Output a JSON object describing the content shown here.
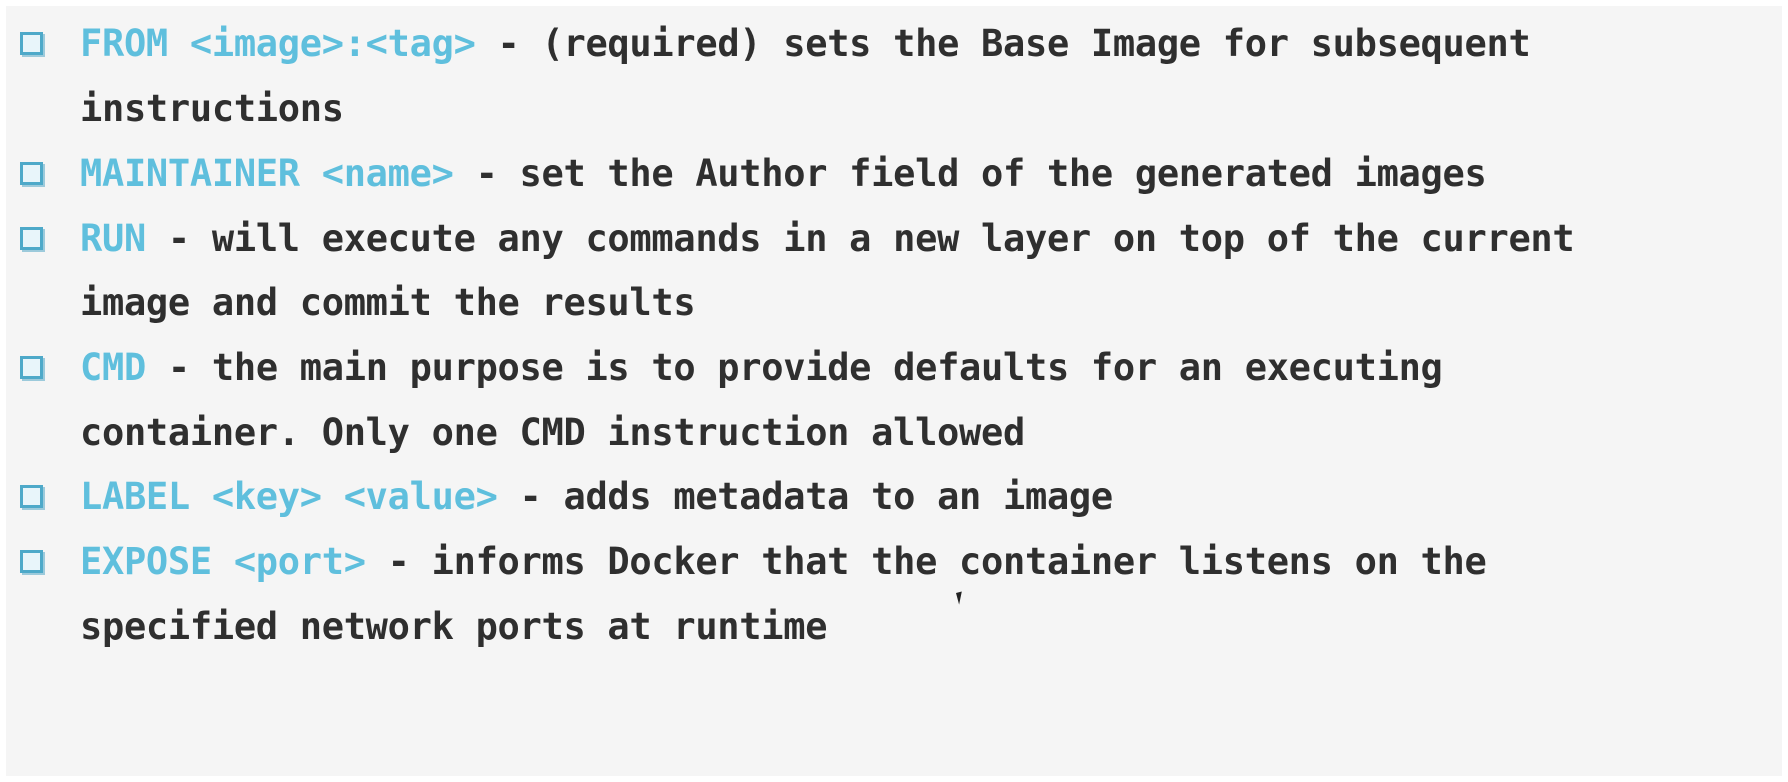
{
  "items": [
    {
      "keyword": "FROM <image>:<tag>",
      "description": " - (required) sets the Base Image for subsequent",
      "continuation": "instructions"
    },
    {
      "keyword": "MAINTAINER <name>",
      "description": " - set the Author field of the generated images"
    },
    {
      "keyword": "RUN",
      "description": " - will execute any commands in a new layer on top of the current",
      "continuation": "image and commit the results"
    },
    {
      "keyword": "CMD",
      "description": " - the main purpose is to provide defaults for an executing",
      "continuation": "container. Only one CMD instruction allowed"
    },
    {
      "keyword": "LABEL <key> <value>",
      "description": " - adds metadata to an image"
    },
    {
      "keyword": "EXPOSE <port>",
      "description": " - informs Docker that the container listens on the",
      "continuation": "specified network ports at runtime"
    }
  ],
  "colors": {
    "keyword": "#5fbfdd",
    "text": "#2f2f2f",
    "background": "#f5f5f5",
    "checkbox_border": "#4ea9c9"
  },
  "icons": {
    "bullet": "checkbox-bullet-icon",
    "cursor": "mouse-pointer-icon"
  }
}
